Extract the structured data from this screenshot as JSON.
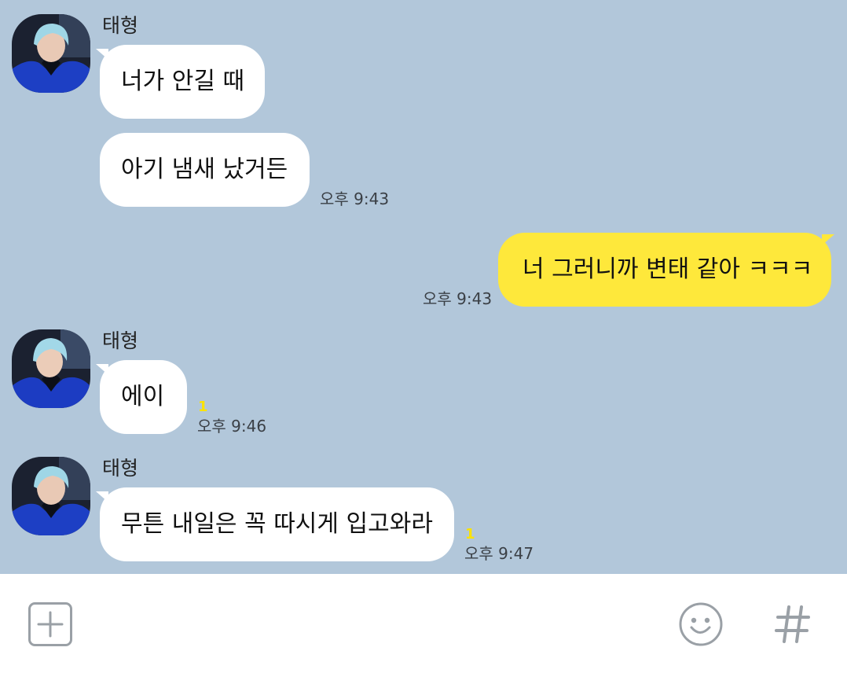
{
  "chat": {
    "messages": [
      {
        "sender": "태형",
        "bubbles": [
          "너가 안길 때",
          "아기 냄새 났거든"
        ],
        "time": "오후 9:43"
      },
      {
        "self": true,
        "text": "너 그러니까 변태 같아 ㅋㅋㅋ",
        "time": "오후 9:43"
      },
      {
        "sender": "태형",
        "text": "에이",
        "unread": "1",
        "time": "오후 9:46"
      },
      {
        "sender": "태형",
        "text": "무튼 내일은 꼭 따시게 입고와라",
        "unread": "1",
        "time": "오후 9:47"
      }
    ]
  },
  "input_bar": {
    "icons": [
      "add-icon",
      "emoji-icon",
      "hashtag-icon"
    ]
  },
  "colors": {
    "chat_background": "#b2c7da",
    "incoming_bubble": "#ffffff",
    "outgoing_bubble": "#fee83b",
    "unread_count": "#fbe300"
  }
}
